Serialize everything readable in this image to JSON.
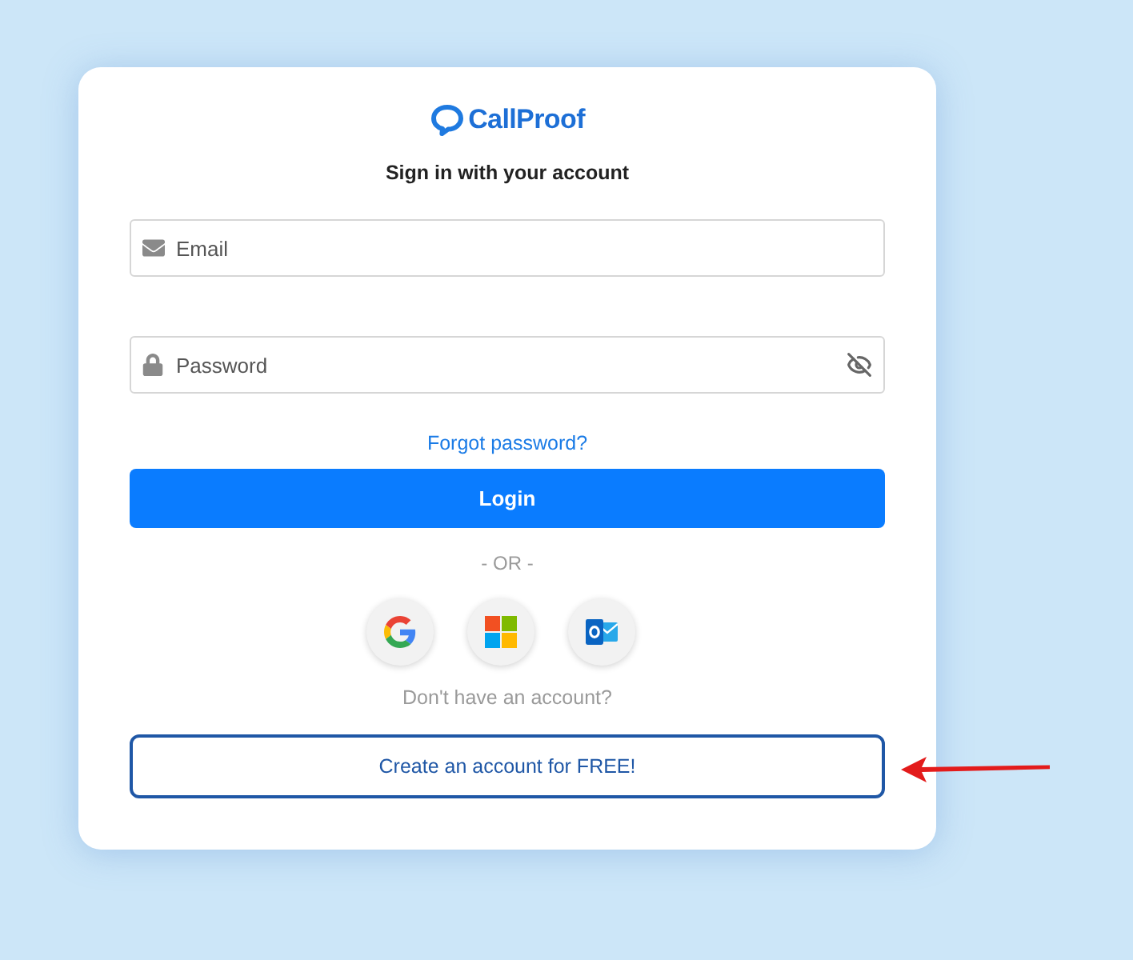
{
  "logo": {
    "text": "CallProof"
  },
  "title": "Sign in with your account",
  "fields": [
    {
      "kind": "email",
      "placeholder": "Email"
    },
    {
      "kind": "password",
      "placeholder": "Password",
      "masked": true
    }
  ],
  "forgot_link": "Forgot password?",
  "login_button": "Login",
  "divider": "- OR -",
  "social_buttons": [
    {
      "kind": "google"
    },
    {
      "kind": "microsoft"
    },
    {
      "kind": "outlook"
    }
  ],
  "signup_prompt": "Don't have an account?",
  "signup_button": "Create an account for FREE!"
}
